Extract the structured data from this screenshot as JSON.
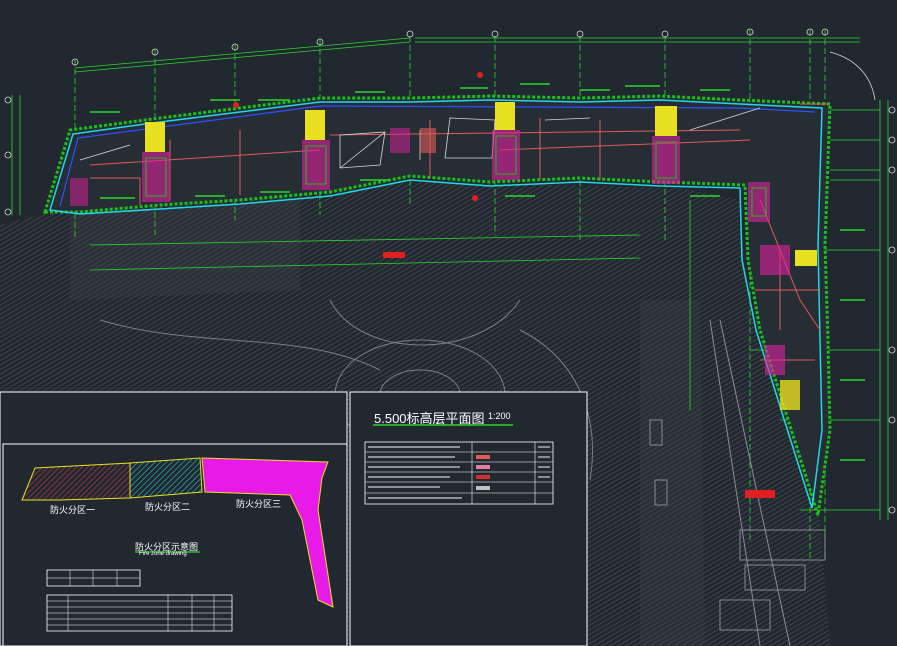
{
  "drawing": {
    "title": "5.500标高层平面图",
    "scale": "1:200"
  },
  "fire_zone_diagram": {
    "title": "防火分区示意图",
    "subtitle": "Fire zone drawing",
    "zones": [
      {
        "label": "防火分区一",
        "color": "#8b1a1a"
      },
      {
        "label": "防火分区二",
        "color": "#1aa6a6"
      },
      {
        "label": "防火分区三",
        "color": "#e81ae8"
      }
    ]
  },
  "colors": {
    "background": "#212830",
    "wall_green": "#18c018",
    "outline_cyan": "#20d8e8",
    "outline_blue": "#3050ff",
    "room_red": "#e05a5a",
    "core_yellow": "#e8e020",
    "core_magenta": "#e020a0",
    "hatch_grey": "#6a6e74",
    "dim_green": "#2bd62b",
    "grid_white": "#d8d8d8"
  }
}
